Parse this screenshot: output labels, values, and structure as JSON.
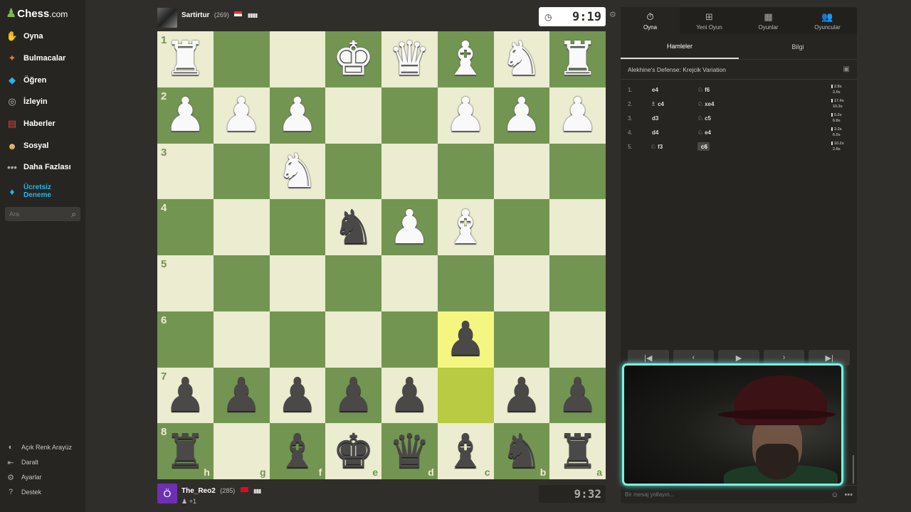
{
  "app": {
    "logo_name": "Chess",
    "logo_domain": ".com"
  },
  "sidebar": {
    "items": [
      {
        "label": "Oyna",
        "icon": "play-hand-icon",
        "color": "#c5a57a"
      },
      {
        "label": "Bulmacalar",
        "icon": "puzzle-icon",
        "color": "#e57b33"
      },
      {
        "label": "Öğren",
        "icon": "learn-cube-icon",
        "color": "#2bb4e8"
      },
      {
        "label": "İzleyin",
        "icon": "binoculars-icon",
        "color": "#bbbbbb"
      },
      {
        "label": "Haberler",
        "icon": "news-icon",
        "color": "#e04040"
      },
      {
        "label": "Sosyal",
        "icon": "social-icon",
        "color": "#f0c070"
      },
      {
        "label": "Daha Fazlası",
        "icon": "more-dots-icon",
        "color": "#aaaaaa"
      }
    ],
    "premium_line1": "Ücretsiz",
    "premium_line2": "Deneme",
    "search_placeholder": "Ara",
    "bottom": [
      {
        "label": "Açık Renk Arayüz",
        "icon": "theme-toggle-icon"
      },
      {
        "label": "Daralt",
        "icon": "collapse-icon"
      },
      {
        "label": "Ayarlar",
        "icon": "gear-icon"
      },
      {
        "label": "Destek",
        "icon": "help-icon"
      }
    ]
  },
  "top_player": {
    "name": "Sartirtur",
    "rating": "(269)",
    "clock": "9:19"
  },
  "bottom_player": {
    "name": "The_Reo2",
    "rating": "(285)",
    "avatar_letter": "Ö",
    "sub": "+1",
    "clock": "9:32"
  },
  "board": {
    "ranks": [
      "1",
      "2",
      "3",
      "4",
      "5",
      "6",
      "7",
      "8"
    ],
    "files": [
      "h",
      "g",
      "f",
      "e",
      "d",
      "c",
      "b",
      "a"
    ],
    "rows": [
      [
        "wR",
        "",
        "",
        "wK",
        "wQ",
        "wB",
        "wN",
        "wR"
      ],
      [
        "wP",
        "wP",
        "wP",
        "",
        "",
        "wP",
        "wP",
        "wP"
      ],
      [
        "",
        "",
        "wN",
        "",
        "",
        "",
        "",
        ""
      ],
      [
        "",
        "",
        "",
        "bN",
        "wP",
        "wB",
        "",
        ""
      ],
      [
        "",
        "",
        "",
        "",
        "",
        "",
        "",
        ""
      ],
      [
        "",
        "",
        "",
        "",
        "",
        "bP",
        "",
        ""
      ],
      [
        "bP",
        "bP",
        "bP",
        "bP",
        "bP",
        "",
        "bP",
        "bP"
      ],
      [
        "bR",
        "",
        "bB",
        "bK",
        "bQ",
        "bB",
        "bN",
        "bR"
      ]
    ],
    "highlight": [
      [
        5,
        5
      ],
      [
        6,
        5
      ]
    ]
  },
  "panel": {
    "tabs": [
      {
        "label": "Oyna",
        "icon": "stopwatch-icon"
      },
      {
        "label": "Yeni Oyun",
        "icon": "plus-icon"
      },
      {
        "label": "Oyunlar",
        "icon": "board-icon"
      },
      {
        "label": "Oyuncular",
        "icon": "players-icon"
      }
    ],
    "subtabs": [
      "Hamleler",
      "Bilgi"
    ],
    "opening": "Alekhine's Defense: Krejcik Variation",
    "moves": [
      {
        "num": "1.",
        "w_piece": "",
        "w": "e4",
        "b_piece": "♘",
        "b": "f6",
        "t1": "2.8s",
        "t2": "2.0s"
      },
      {
        "num": "2.",
        "w_piece": "♗",
        "w": "c4",
        "b_piece": "♘",
        "b": "xe4",
        "t1": "17.4s",
        "t2": "10.3s"
      },
      {
        "num": "3.",
        "w_piece": "",
        "w": "d3",
        "b_piece": "♘",
        "b": "c5",
        "t1": "5.2s",
        "t2": "6.8s"
      },
      {
        "num": "4.",
        "w_piece": "",
        "w": "d4",
        "b_piece": "♘",
        "b": "e4",
        "t1": "3.2s",
        "t2": "6.0s"
      },
      {
        "num": "5.",
        "w_piece": "♘",
        "w": "f3",
        "b_piece": "",
        "b": "c6",
        "t1": "10.2s",
        "t2": "2.8s"
      }
    ],
    "controls": [
      "first-move-icon",
      "prev-move-icon",
      "play-icon",
      "next-move-icon",
      "last-move-icon"
    ],
    "chat_placeholder": "Bir mesaj yollayın..."
  },
  "colors": {
    "light_square": "#ebecd0",
    "dark_square": "#739552",
    "highlight": "#f5f682",
    "accent": "#81b64c"
  }
}
